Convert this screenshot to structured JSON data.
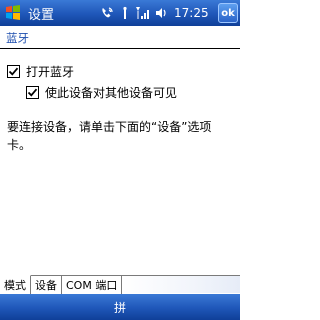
{
  "titlebar": {
    "title": "设置",
    "time": "17:25",
    "ok_label": "ok",
    "icons": [
      "windows-start-icon",
      "phone-signal-icon",
      "antenna-icon",
      "signal-strength-icon",
      "volume-icon"
    ]
  },
  "section": {
    "header": "蓝牙"
  },
  "options": {
    "enable_bluetooth": {
      "label": "打开蓝牙",
      "checked": true
    },
    "discoverable": {
      "label": "使此设备对其他设备可见",
      "checked": true
    }
  },
  "info": {
    "text": "要连接设备，请单击下面的“设备”选项卡。"
  },
  "tabs": [
    {
      "label": "模式",
      "active": true
    },
    {
      "label": "设备",
      "active": false
    },
    {
      "label": "COM 端口",
      "active": false
    }
  ],
  "menubar": {
    "sip_label": "拼"
  },
  "colors": {
    "bar_blue": "#1f56b8",
    "header_text": "#1f4fae"
  }
}
